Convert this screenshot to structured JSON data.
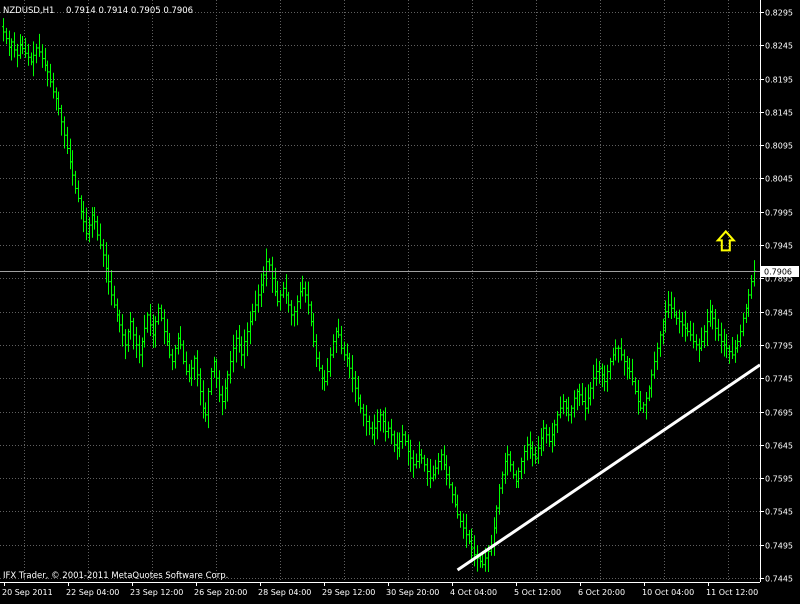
{
  "chart_data": {
    "type": "candlestick",
    "symbol": "NZDUSD,H1",
    "ohlc_header": "0.7914 0.7914 0.7905 0.7906",
    "copyright": "IFX Trader, © 2001-2011 MetaQuotes Software Corp.",
    "current_price": "0.7906",
    "ylim": [
      0.7445,
      0.8295
    ],
    "price_ticks": [
      "0.8295",
      "0.8245",
      "0.8195",
      "0.8145",
      "0.8095",
      "0.8045",
      "0.7995",
      "0.7945",
      "0.7895",
      "0.7845",
      "0.7795",
      "0.7745",
      "0.7695",
      "0.7645",
      "0.7595",
      "0.7545",
      "0.7495",
      "0.7445"
    ],
    "time_labels": [
      "20 Sep 2011",
      "22 Sep 04:00",
      "23 Sep 12:00",
      "26 Sep 20:00",
      "28 Sep 04:00",
      "29 Sep 12:00",
      "30 Sep 20:00",
      "4 Oct 04:00",
      "5 Oct 12:00",
      "6 Oct 20:00",
      "10 Oct 04:00",
      "11 Oct 12:00"
    ],
    "grid": true,
    "bar_color": "#00ff00",
    "trendline": {
      "color": "#ffffff",
      "from": {
        "bar": 0.602,
        "price": 0.7457
      },
      "to": {
        "bar": 1.0,
        "price": 0.7765
      }
    },
    "arrow": {
      "type": "buy-arrow",
      "color": "#ffff00",
      "bar": 0.955,
      "price": 0.7955
    },
    "close_series": [
      0.8265,
      0.8255,
      0.8242,
      0.825,
      0.8238,
      0.823,
      0.8246,
      0.824,
      0.8233,
      0.8227,
      0.822,
      0.823,
      0.8241,
      0.8235,
      0.8225,
      0.8215,
      0.8205,
      0.819,
      0.8175,
      0.8165,
      0.815,
      0.813,
      0.811,
      0.809,
      0.807,
      0.805,
      0.803,
      0.8015,
      0.7995,
      0.798,
      0.7962,
      0.7975,
      0.799,
      0.798,
      0.796,
      0.7945,
      0.793,
      0.791,
      0.789,
      0.787,
      0.7855,
      0.784,
      0.7825,
      0.781,
      0.7795,
      0.7815,
      0.783,
      0.781,
      0.7795,
      0.778,
      0.78,
      0.782,
      0.784,
      0.7825,
      0.781,
      0.783,
      0.785,
      0.7835,
      0.7815,
      0.78,
      0.778,
      0.777,
      0.779,
      0.7805,
      0.7795,
      0.777,
      0.7755,
      0.7745,
      0.776,
      0.7775,
      0.775,
      0.7725,
      0.77,
      0.769,
      0.7725,
      0.7755,
      0.777,
      0.7745,
      0.772,
      0.771,
      0.773,
      0.775,
      0.777,
      0.779,
      0.7805,
      0.7795,
      0.778,
      0.78,
      0.7815,
      0.783,
      0.7845,
      0.7855,
      0.787,
      0.7885,
      0.79,
      0.792,
      0.7915,
      0.7895,
      0.7875,
      0.786,
      0.787,
      0.788,
      0.787,
      0.7855,
      0.784,
      0.7845,
      0.786,
      0.7875,
      0.788,
      0.787,
      0.7855,
      0.783,
      0.78,
      0.7775,
      0.776,
      0.7745,
      0.774,
      0.7755,
      0.778,
      0.78,
      0.7815,
      0.781,
      0.779,
      0.778,
      0.7775,
      0.776,
      0.7745,
      0.773,
      0.7715,
      0.77,
      0.769,
      0.768,
      0.767,
      0.766,
      0.767,
      0.768,
      0.769,
      0.768,
      0.7665,
      0.767,
      0.766,
      0.7645,
      0.764,
      0.765,
      0.766,
      0.765,
      0.7635,
      0.7625,
      0.7615,
      0.762,
      0.763,
      0.7625,
      0.7615,
      0.7605,
      0.7595,
      0.76,
      0.761,
      0.762,
      0.763,
      0.7615,
      0.76,
      0.7585,
      0.757,
      0.7555,
      0.754,
      0.753,
      0.752,
      0.751,
      0.75,
      0.749,
      0.748,
      0.7475,
      0.747,
      0.7465,
      0.7475,
      0.7485,
      0.7495,
      0.752,
      0.755,
      0.758,
      0.76,
      0.762,
      0.763,
      0.7615,
      0.76,
      0.759,
      0.7605,
      0.762,
      0.7635,
      0.7645,
      0.764,
      0.763,
      0.7625,
      0.764,
      0.7655,
      0.767,
      0.766,
      0.765,
      0.766,
      0.7675,
      0.769,
      0.77,
      0.771,
      0.77,
      0.769,
      0.77,
      0.7715,
      0.7725,
      0.772,
      0.771,
      0.77,
      0.7715,
      0.773,
      0.7745,
      0.7755,
      0.776,
      0.775,
      0.774,
      0.7755,
      0.777,
      0.778,
      0.779,
      0.779,
      0.778,
      0.777,
      0.776,
      0.7755,
      0.774,
      0.7725,
      0.771,
      0.77,
      0.7705,
      0.7715,
      0.773,
      0.775,
      0.777,
      0.779,
      0.781,
      0.783,
      0.7845,
      0.7855,
      0.785,
      0.784,
      0.7835,
      0.783,
      0.7825,
      0.782,
      0.7815,
      0.781,
      0.78,
      0.7795,
      0.779,
      0.78,
      0.7815,
      0.783,
      0.7845,
      0.7835,
      0.782,
      0.781,
      0.78,
      0.7795,
      0.779,
      0.7785,
      0.778,
      0.779,
      0.78,
      0.7815,
      0.7835,
      0.785,
      0.787,
      0.789,
      0.7906
    ]
  }
}
